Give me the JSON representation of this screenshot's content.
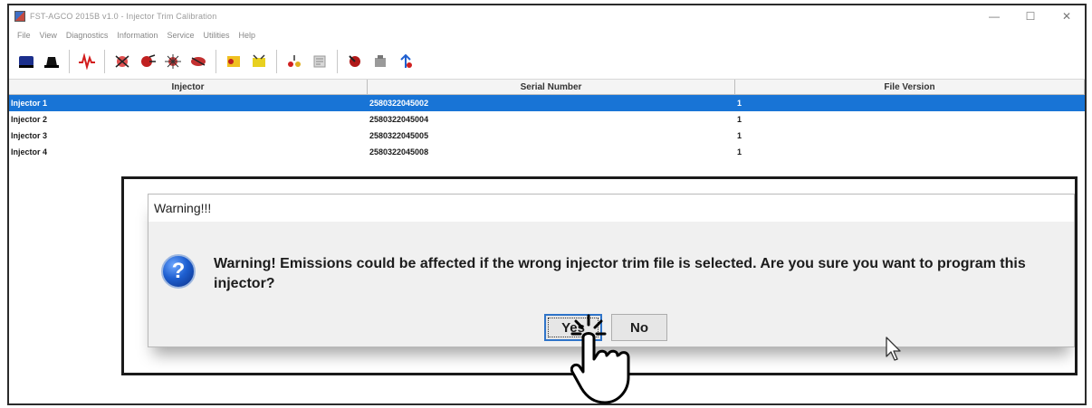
{
  "window": {
    "title": "FST-AGCO 2015B v1.0 - Injector Trim Calibration",
    "controls": {
      "minimize": "—",
      "maximize": "☐",
      "close": "✕"
    }
  },
  "menu": [
    "File",
    "View",
    "Diagnostics",
    "Information",
    "Service",
    "Utilities",
    "Help"
  ],
  "toolbar": {
    "icons": [
      "connect-icon",
      "disconnect-icon",
      "waveform-icon",
      "sensor-test-icon",
      "injector-test-icon",
      "cylinder-cutout-icon",
      "relative-compression-icon",
      "parameter-icon",
      "calibration-icon",
      "snapshot-icon",
      "report-icon",
      "trim-download-icon",
      "engine-icon",
      "upload-icon"
    ]
  },
  "table": {
    "columns": [
      "Injector",
      "Serial Number",
      "File Version"
    ],
    "rows": [
      {
        "injector": "Injector 1",
        "serial": "2580322045002",
        "version": "1"
      },
      {
        "injector": "Injector 2",
        "serial": "2580322045004",
        "version": "1"
      },
      {
        "injector": "Injector 3",
        "serial": "2580322045005",
        "version": "1"
      },
      {
        "injector": "Injector 4",
        "serial": "2580322045008",
        "version": "1"
      }
    ],
    "selected_row": 0
  },
  "dialog": {
    "title": "Warning!!!",
    "icon": "question-icon",
    "message": "Warning!  Emissions could be affected if the wrong injector trim file is selected.  Are you sure you want to program this injector?",
    "buttons": {
      "yes": "Yes",
      "no": "No"
    }
  },
  "colors": {
    "selection": "#1874d6",
    "dialog_bg": "#f0f0f0",
    "frame": "#1a1a1a"
  }
}
